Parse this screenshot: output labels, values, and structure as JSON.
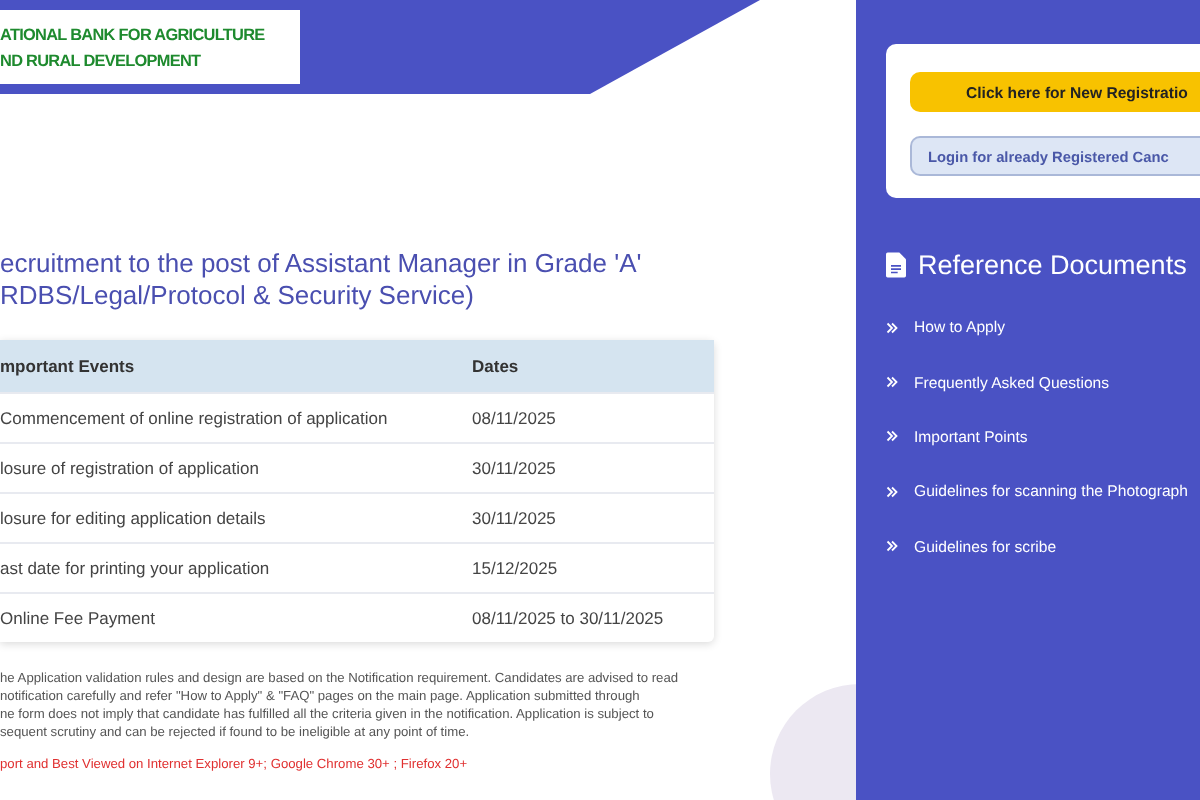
{
  "header": {
    "logo_lines": [
      "ATIONAL BANK FOR AGRICULTURE",
      "ND RURAL DEVELOPMENT"
    ]
  },
  "title_lines": [
    "ecruitment to the post of Assistant Manager in Grade 'A'",
    "RDBS/Legal/Protocol & Security Service)"
  ],
  "table": {
    "columns": [
      "mportant Events",
      "Dates"
    ],
    "rows": [
      [
        "Commencement of online registration of application",
        "08/11/2025"
      ],
      [
        "losure of registration of application",
        "30/11/2025"
      ],
      [
        "losure for editing application details",
        "30/11/2025"
      ],
      [
        "ast date for printing your application",
        "15/12/2025"
      ],
      [
        "Online Fee Payment",
        "08/11/2025 to 30/11/2025"
      ]
    ]
  },
  "notice_lines": [
    "he Application validation rules and design are based on the Notification requirement. Candidates are advised to read",
    "notification carefully and refer \"How to Apply\" & \"FAQ\" pages on the main page. Application submitted through",
    "ne form does not imply that candidate has fulfilled all the criteria given in the notification. Application is subject to",
    "sequent scrutiny and can be rejected if found to be ineligible at any point of time."
  ],
  "browser_note": "port and Best Viewed on Internet Explorer 9+; Google Chrome 30+ ; Firefox 20+",
  "sidebar": {
    "buttons": [
      {
        "label": "Click here for New Registratio",
        "kind": "primary"
      },
      {
        "label": "Login for already Registered Canc",
        "kind": "secondary"
      }
    ],
    "heading": "Reference Documents",
    "links": [
      "How to Apply",
      "Frequently Asked Questions",
      "Important Points",
      "Guidelines for scanning the Photograph",
      "Guidelines for scribe"
    ]
  }
}
